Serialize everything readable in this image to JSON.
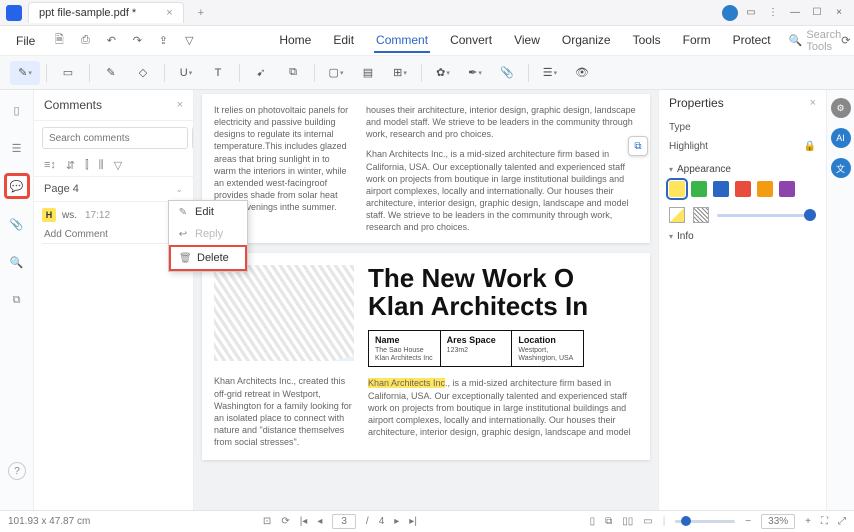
{
  "titlebar": {
    "filename": "ppt file-sample.pdf *"
  },
  "menubar": {
    "file": "File",
    "tabs": {
      "home": "Home",
      "edit": "Edit",
      "comment": "Comment",
      "convert": "Convert",
      "view": "View",
      "organize": "Organize",
      "tools": "Tools",
      "form": "Form",
      "protect": "Protect"
    },
    "search_placeholder": "Search Tools"
  },
  "comments": {
    "title": "Comments",
    "search_placeholder": "Search comments",
    "page_label": "Page 4",
    "item": {
      "badge": "H",
      "user": "ws.",
      "time": "17:12"
    },
    "add_placeholder": "Add Comment"
  },
  "context_menu": {
    "edit": "Edit",
    "reply": "Reply",
    "delete": "Delete"
  },
  "doc": {
    "p1_left": "It relies on photovoltaic panels for electricity and passive building designs to regulate its internal temperature.This includes glazed areas that bring sunlight in to warm the interiors in winter, while an extended west-facingroof provides shade from solar heat during evenings inthe summer.",
    "p1_right": "houses their architecture, interior design, graphic design, landscape and model staff. We strieve to be leaders in the community through work, research and pro choices.",
    "p1b": "Khan Architects Inc., is a mid-sized architecture firm based in California, USA. Our exceptionally talented and experienced staff work on projects from boutique in large institutional buildings and airport complexes, locally and internationally. Our houses their architecture, interior design, graphic design, landscape and model staff. We strieve to be leaders in the community through work, research and pro choices.",
    "headline1": "The New Work O",
    "headline2": "Klan Architects In",
    "info": {
      "name_lbl": "Name",
      "name_val": "The Sao House Klan Architects Inc",
      "area_lbl": "Ares Space",
      "area_val": "123m2",
      "loc_lbl": "Location",
      "loc_val": "Westport, Washington, USA"
    },
    "p2_left": "Khan Architects Inc., created this off-grid retreat in Westport, Washington for a family looking for an isolated place to connect with nature and \"distance themselves from social stresses\".",
    "p2_hl": "Khan Architects Inc",
    "p2_right": "., is a mid-sized architecture firm based in California, USA. Our exceptionally talented and experienced staff work on projects from boutique in large institutional buildings and airport complexes, locally and internationally. Our houses their architecture, interior design, graphic design, landscape and model"
  },
  "properties": {
    "title": "Properties",
    "type_lbl": "Type",
    "type_val": "Highlight",
    "appearance": "Appearance",
    "info": "Info",
    "swatches": [
      "#ffe45e",
      "#39b54a",
      "#2b66c4",
      "#e74c3c",
      "#f39c12",
      "#8e44ad"
    ]
  },
  "statusbar": {
    "dims": "101.93 x 47.87 cm",
    "page": "3",
    "total": "4",
    "zoom": "33%"
  }
}
